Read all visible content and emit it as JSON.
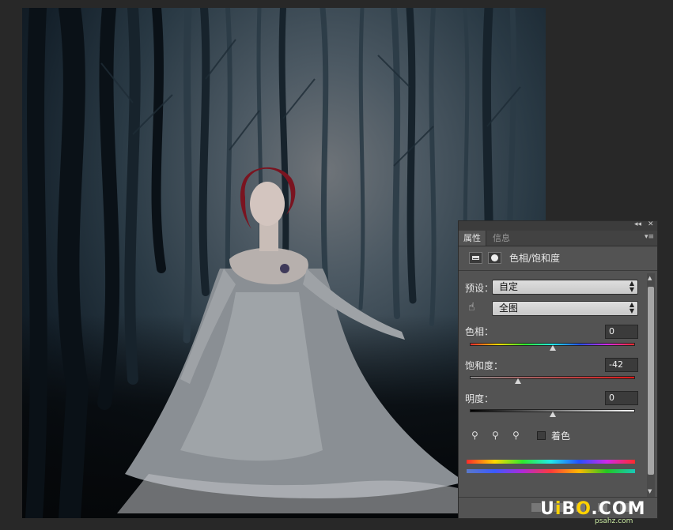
{
  "panel": {
    "collapse_icon": "◂◂",
    "close_icon": "✕",
    "tabs": [
      {
        "label": "属性",
        "active": true
      },
      {
        "label": "信息",
        "active": false
      }
    ],
    "menu_icon": "▾≡",
    "title": "色相/饱和度",
    "preset": {
      "label": "预设：",
      "value": "自定"
    },
    "channel": {
      "value": "全图"
    },
    "hue": {
      "label": "色相：",
      "value": "0",
      "fraction": 0.5
    },
    "saturation": {
      "label": "饱和度：",
      "value": "-42",
      "fraction": 0.29
    },
    "lightness": {
      "label": "明度：",
      "value": "0",
      "fraction": 0.5
    },
    "colorize": {
      "label": "着色",
      "checked": false
    },
    "eyedropper_icons": [
      "eyedropper-icon",
      "eyedropper-plus-icon",
      "eyedropper-minus-icon"
    ]
  },
  "watermark": {
    "brand_u": "U",
    "brand_i": "i",
    "brand_b": "B",
    "brand_o": "O",
    "brand_dot": ".",
    "brand_com": "COM",
    "site": "psahz.com"
  },
  "colors": {
    "panel_bg": "#535353",
    "workspace_bg": "#282828",
    "watermark_accent": "#ffd200"
  }
}
